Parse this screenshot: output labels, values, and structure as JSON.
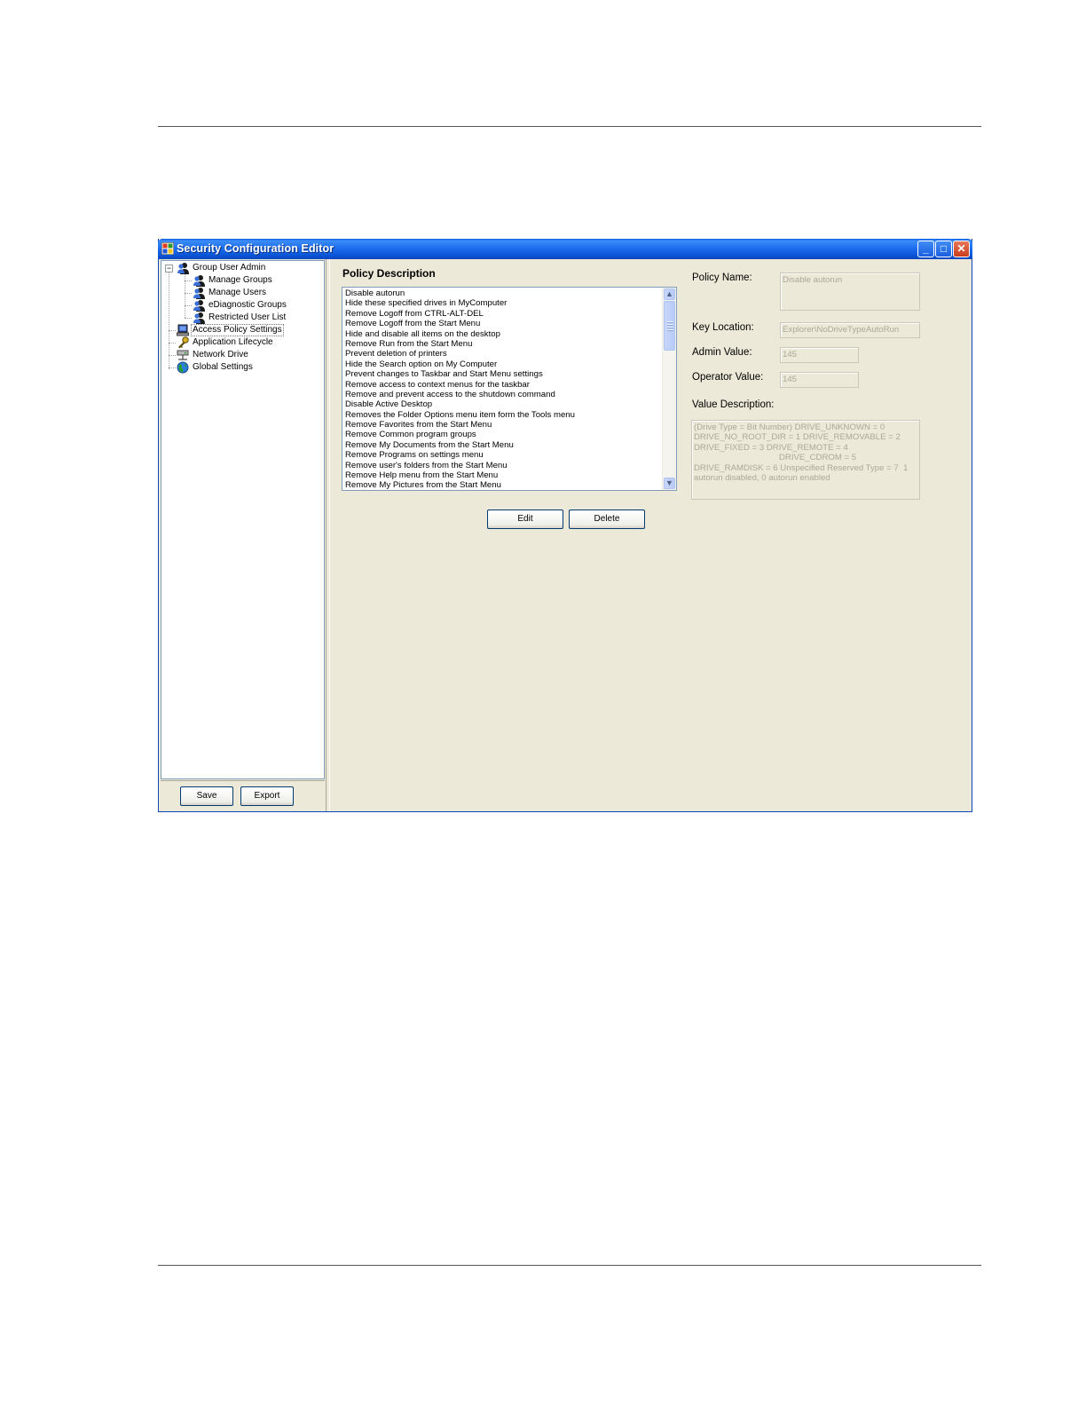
{
  "window": {
    "title": "Security Configuration Editor",
    "minimize": "_",
    "maximize": "□",
    "close": "✕"
  },
  "tree": {
    "root_expander": "−",
    "items": [
      {
        "label": "Group User Admin",
        "icon": "group-admin-icon"
      },
      {
        "label": "Manage Groups",
        "icon": "manage-groups-icon"
      },
      {
        "label": "Manage Users",
        "icon": "manage-users-icon"
      },
      {
        "label": "eDiagnostic Groups",
        "icon": "ediagnostic-groups-icon"
      },
      {
        "label": "Restricted User List",
        "icon": "restricted-user-list-icon"
      },
      {
        "label": "Access Policy Settings",
        "icon": "access-policy-icon"
      },
      {
        "label": "Application Lifecycle",
        "icon": "application-lifecycle-icon"
      },
      {
        "label": "Network Drive",
        "icon": "network-drive-icon"
      },
      {
        "label": "Global Settings",
        "icon": "global-settings-icon"
      }
    ]
  },
  "footer": {
    "save_label": "Save",
    "export_label": "Export"
  },
  "policy": {
    "section_title": "Policy Description",
    "items": [
      "Disable autorun",
      "Hide these specified drives in MyComputer",
      "Remove Logoff from CTRL-ALT-DEL",
      "Remove Logoff from the Start Menu",
      "Hide and disable all items on the desktop",
      "Remove Run from the Start Menu",
      "Prevent deletion of printers",
      "Hide the Search option on My Computer",
      "Prevent changes to Taskbar and Start Menu settings",
      "Remove access to context menus for the taskbar",
      "Remove and prevent access to the shutdown command",
      "Disable Active Desktop",
      "Removes the Folder Options menu item form the Tools menu",
      "Remove Favorites from the Start Menu",
      "Remove Common program groups",
      "Remove My Documents from the Start Menu",
      "Remove Programs on settings menu",
      "Remove user's folders from the Start Menu",
      "Remove Help menu from the Start Menu",
      "Remove My Pictures from the Start Menu"
    ],
    "edit_label": "Edit",
    "delete_label": "Delete"
  },
  "details": {
    "policy_name_label": "Policy Name:",
    "policy_name_value": "Disable autorun",
    "key_location_label": "Key Location:",
    "key_location_value": "Explorer\\NoDriveTypeAutoRun",
    "admin_value_label": "Admin Value:",
    "admin_value": "145",
    "operator_value_label": "Operator Value:",
    "operator_value": "145",
    "value_description_label": "Value Description:",
    "value_description_lines": [
      "(Drive Type = Bit Number) DRIVE_UNKNOWN = 0",
      "DRIVE_NO_ROOT_DIR = 1 DRIVE_REMOVABLE = 2",
      "DRIVE_FIXED = 3 DRIVE_REMOTE = 4",
      "                                    DRIVE_CDROM = 5",
      "DRIVE_RAMDISK = 6 Unspecified Reserved Type = 7  1",
      "autorun disabled, 0 autorun enabled"
    ]
  },
  "colors": {
    "titlebar": "#0b55d8",
    "window_bg": "#ece9d8",
    "disabled_text": "#aca899"
  }
}
